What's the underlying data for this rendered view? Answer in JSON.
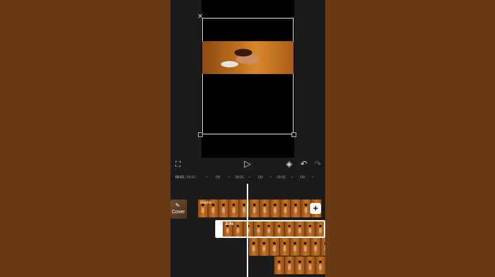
{
  "preview": {
    "close_icon": "close-icon"
  },
  "controls": {
    "fullscreen_icon": "fullscreen-icon",
    "play_icon": "play-icon",
    "keyframe_icon": "keyframe-icon",
    "undo_icon": "undo-icon",
    "redo_icon": "redo-icon",
    "fullscreen_glyph": "⛶",
    "play_glyph": "▷",
    "keyframe_glyph": "◈",
    "undo_glyph": "↶",
    "redo_glyph": "↷"
  },
  "ruler": {
    "current_time": "00:01",
    "separator": " / ",
    "total_time": "00:02",
    "ticks": [
      "15f",
      "00:01",
      "15f",
      "00:02",
      "15f"
    ]
  },
  "timeline": {
    "cover_label": "Cover",
    "graphs_label": "Graphs",
    "clip_duration": "2.4s",
    "add_label": "+"
  },
  "colors": {
    "background": "#6a3a13",
    "app": "#1b1b1b",
    "accent": "#ffffff"
  }
}
